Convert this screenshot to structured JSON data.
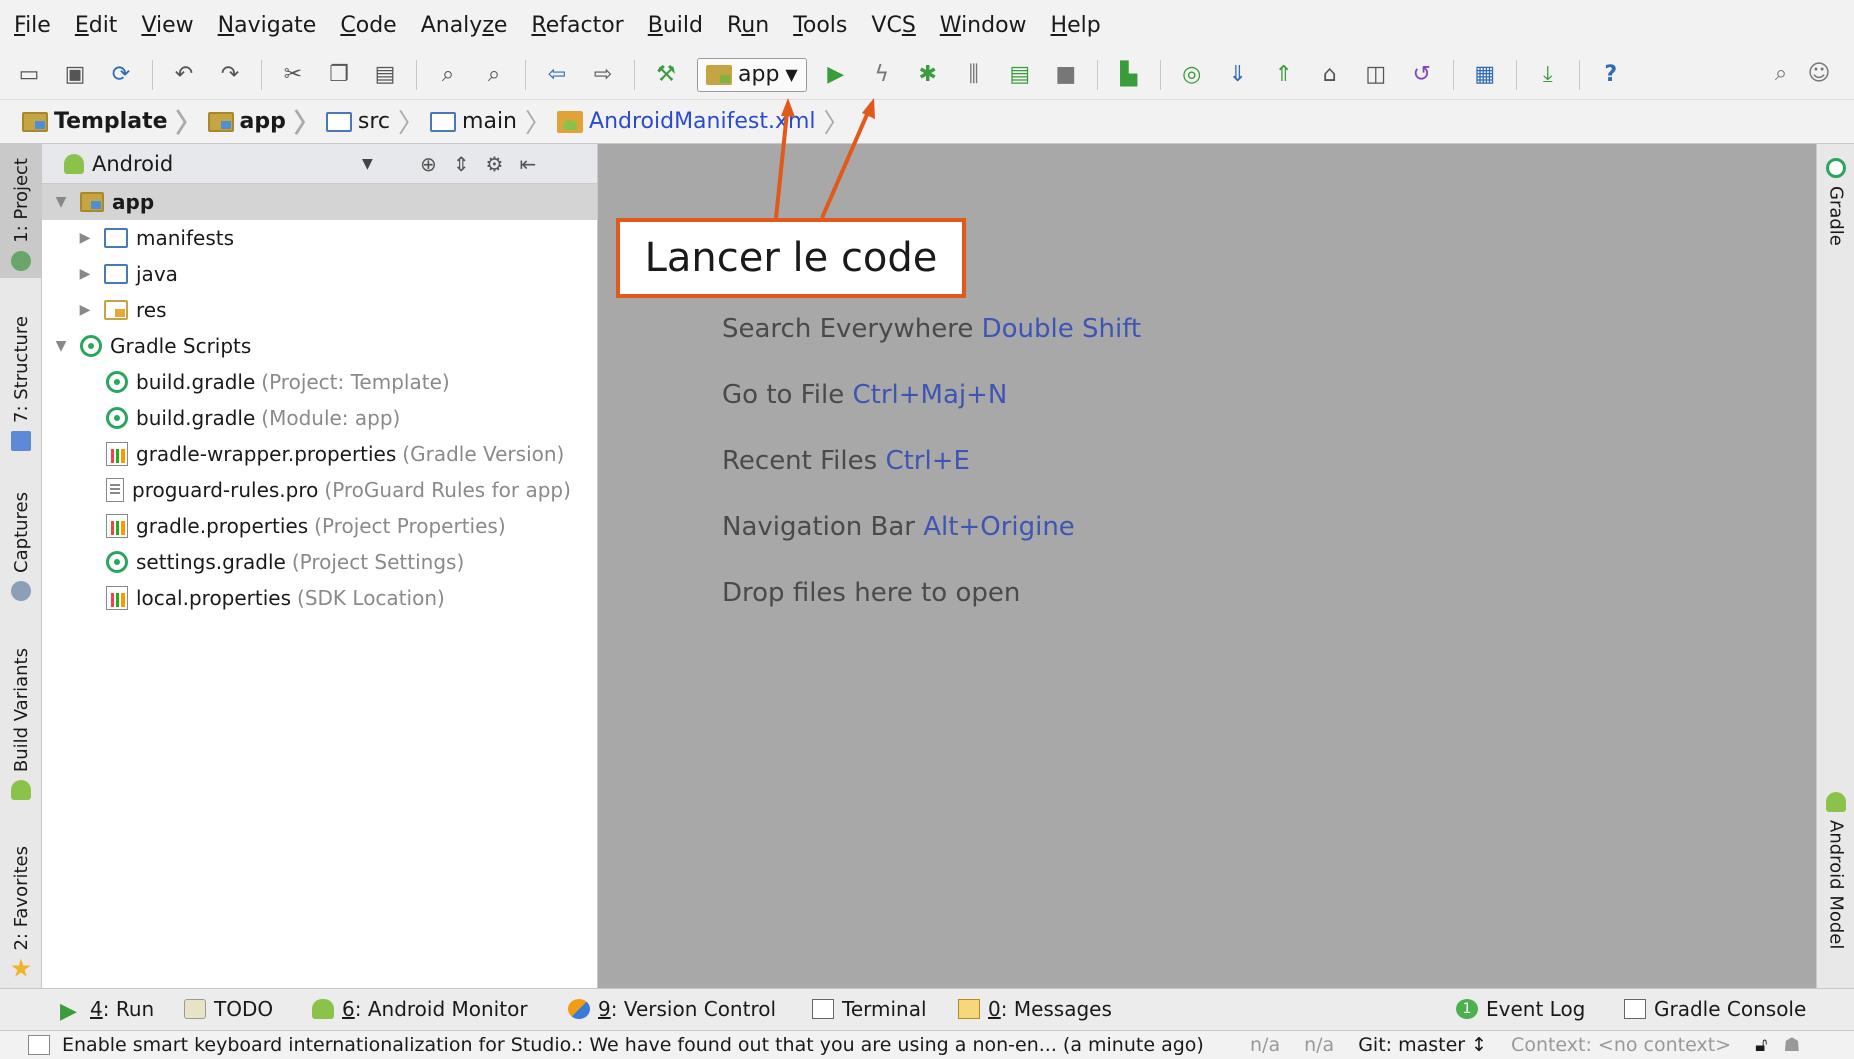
{
  "menu": [
    {
      "pre": "",
      "u": "F",
      "post": "ile"
    },
    {
      "pre": "",
      "u": "E",
      "post": "dit"
    },
    {
      "pre": "",
      "u": "V",
      "post": "iew"
    },
    {
      "pre": "",
      "u": "N",
      "post": "avigate"
    },
    {
      "pre": "",
      "u": "C",
      "post": "ode"
    },
    {
      "pre": "Analy",
      "u": "z",
      "post": "e"
    },
    {
      "pre": "",
      "u": "R",
      "post": "efactor"
    },
    {
      "pre": "",
      "u": "B",
      "post": "uild"
    },
    {
      "pre": "R",
      "u": "u",
      "post": "n"
    },
    {
      "pre": "",
      "u": "T",
      "post": "ools"
    },
    {
      "pre": "VC",
      "u": "S",
      "post": ""
    },
    {
      "pre": "",
      "u": "W",
      "post": "indow"
    },
    {
      "pre": "",
      "u": "H",
      "post": "elp"
    }
  ],
  "toolbar": {
    "run_config": "app",
    "help_label": "?"
  },
  "breadcrumb": [
    "Template",
    "app",
    "src",
    "main",
    "AndroidManifest.xml"
  ],
  "project_panel": {
    "view_mode": "Android",
    "tree": [
      {
        "label": "app",
        "meta": "",
        "icon": "module-folder",
        "level": 0,
        "arrow": "▼",
        "selected": true,
        "bold": true
      },
      {
        "label": "manifests",
        "meta": "",
        "icon": "folder",
        "level": 1,
        "arrow": "▶"
      },
      {
        "label": "java",
        "meta": "",
        "icon": "folder",
        "level": 1,
        "arrow": "▶"
      },
      {
        "label": "res",
        "meta": "",
        "icon": "res-folder",
        "level": 1,
        "arrow": "▶"
      },
      {
        "label": "Gradle Scripts",
        "meta": "",
        "icon": "gradle",
        "level": 0,
        "arrow": "▼"
      },
      {
        "label": "build.gradle",
        "meta": "(Project: Template)",
        "icon": "gradle",
        "level": 2,
        "arrow": ""
      },
      {
        "label": "build.gradle",
        "meta": "(Module: app)",
        "icon": "gradle",
        "level": 2,
        "arrow": ""
      },
      {
        "label": "gradle-wrapper.properties",
        "meta": "(Gradle Version)",
        "icon": "props",
        "level": 2,
        "arrow": ""
      },
      {
        "label": "proguard-rules.pro",
        "meta": "(ProGuard Rules for app)",
        "icon": "text",
        "level": 2,
        "arrow": ""
      },
      {
        "label": "gradle.properties",
        "meta": "(Project Properties)",
        "icon": "props",
        "level": 2,
        "arrow": ""
      },
      {
        "label": "settings.gradle",
        "meta": "(Project Settings)",
        "icon": "gradle",
        "level": 2,
        "arrow": ""
      },
      {
        "label": "local.properties",
        "meta": "(SDK Location)",
        "icon": "props",
        "level": 2,
        "arrow": ""
      }
    ]
  },
  "left_tabs": [
    "1: Project",
    "7: Structure",
    "Captures",
    "Build Variants",
    "2: Favorites"
  ],
  "right_tabs": [
    "Gradle",
    "Android Model"
  ],
  "editor_hints": [
    {
      "text": "Search Everywhere ",
      "shortcut": "Double Shift"
    },
    {
      "text": "Go to File ",
      "shortcut": "Ctrl+Maj+N"
    },
    {
      "text": "Recent Files ",
      "shortcut": "Ctrl+E"
    },
    {
      "text": "Navigation Bar ",
      "shortcut": "Alt+Origine"
    },
    {
      "text": "Drop files here to open",
      "shortcut": ""
    }
  ],
  "callout": {
    "text": "Lancer le code",
    "color": "#e05a1c"
  },
  "bottom_tabs": {
    "run": {
      "u": "4",
      "rest": ": Run"
    },
    "todo": "TODO",
    "android_monitor": {
      "u": "6",
      "rest": ": Android Monitor"
    },
    "version_control": {
      "u": "9",
      "rest": ": Version Control"
    },
    "terminal": "Terminal",
    "messages": {
      "u": "0",
      "rest": ": Messages"
    },
    "event_log": "Event Log",
    "event_log_badge": "1",
    "gradle_console": "Gradle Console"
  },
  "status": {
    "message": "Enable smart keyboard internationalization for Studio.: We have found out that you are using a non-en... (a minute ago)",
    "na1": "n/a",
    "na2": "n/a",
    "git": "Git: master ↕",
    "context": "Context: <no context>"
  },
  "colors": {
    "run_green": "#3a9c3a",
    "link_blue": "#3e56b3",
    "callout_orange": "#e05a1c"
  }
}
